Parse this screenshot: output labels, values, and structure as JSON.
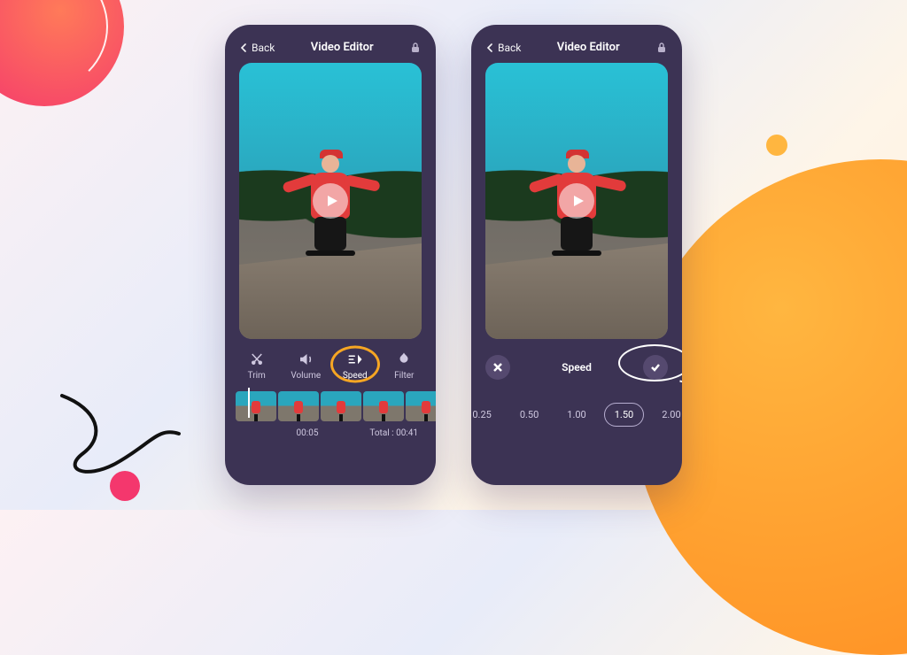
{
  "header": {
    "back_label": "Back",
    "title": "Video Editor"
  },
  "tools": {
    "trim": "Trim",
    "volume": "Volume",
    "speed": "Speed",
    "filter": "Filter"
  },
  "timeline": {
    "current": "00:05",
    "total_label": "Total : 00:41"
  },
  "speed_panel": {
    "title": "Speed",
    "options": [
      "0.25",
      "0.50",
      "1.00",
      "1.50",
      "2.00"
    ],
    "selected": "1.50"
  }
}
